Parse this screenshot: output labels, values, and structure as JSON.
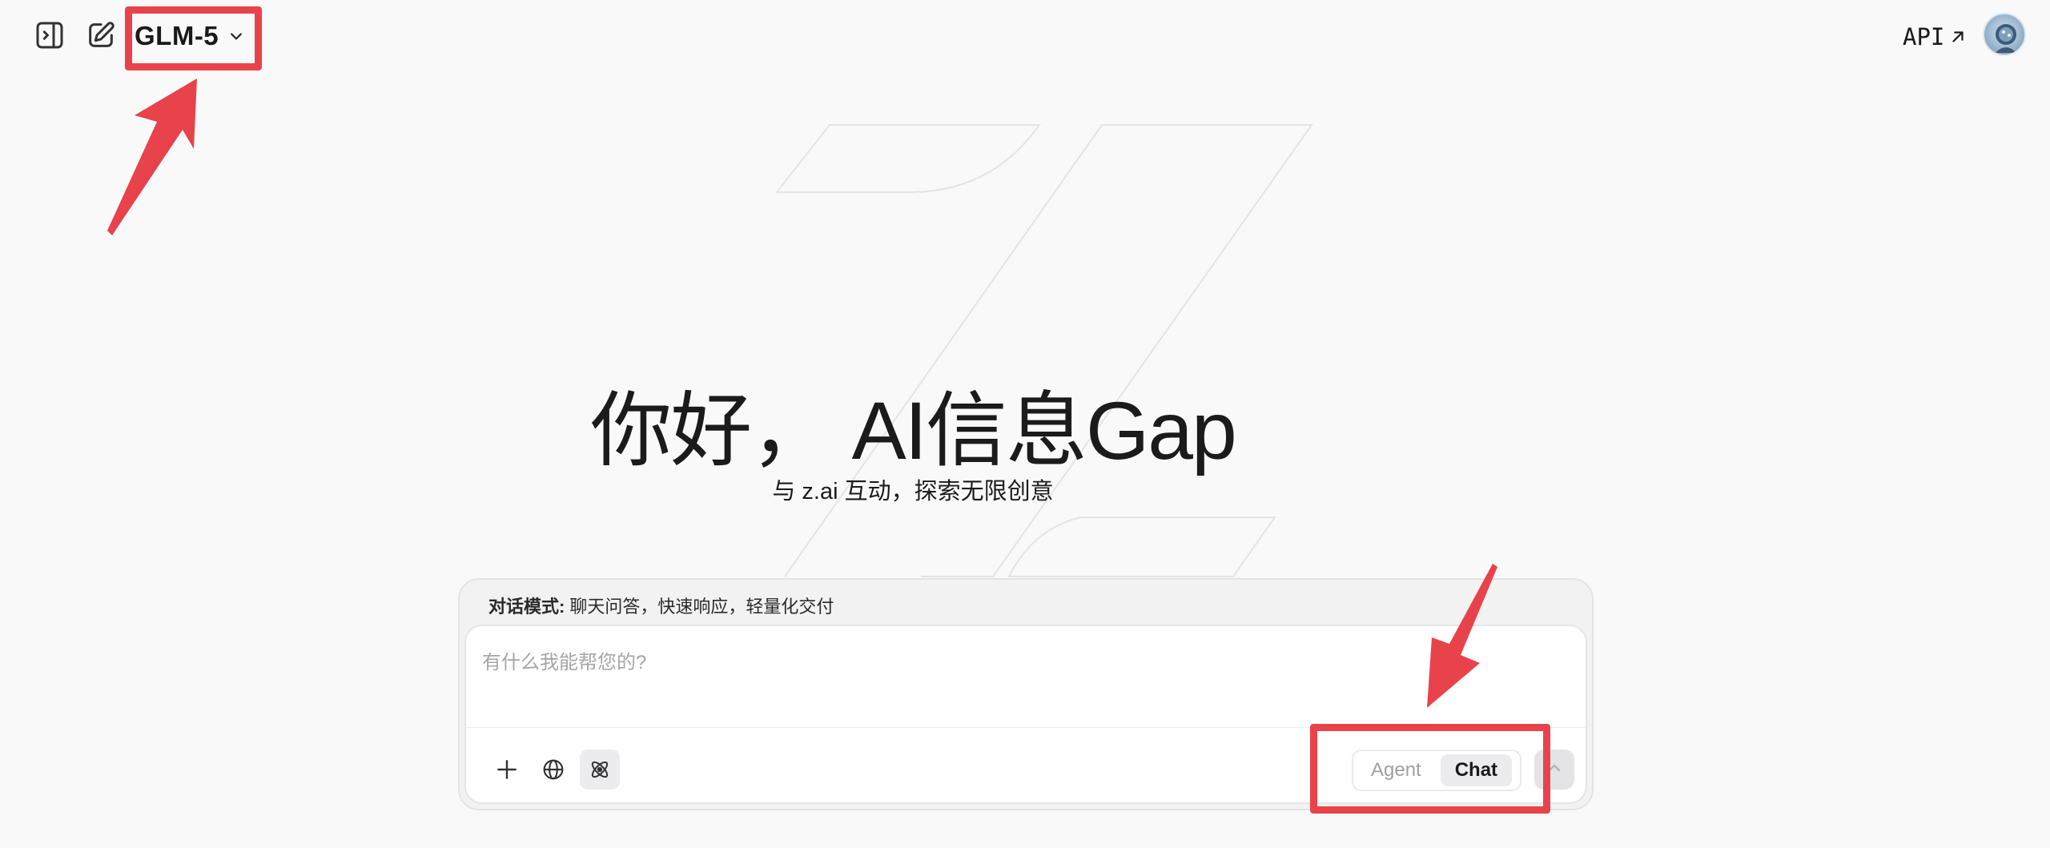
{
  "header": {
    "model_name": "GLM-5",
    "api_label": "API"
  },
  "hero": {
    "greeting": "你好， AI信息Gap",
    "subtitle": "与 z.ai 互动，探索无限创意"
  },
  "composer": {
    "mode_hint_label": "对话模式:",
    "mode_hint_text": "聊天问答，快速响应，轻量化交付",
    "placeholder": "有什么我能帮您的?",
    "modes": [
      "Agent",
      "Chat"
    ],
    "active_mode": "Chat"
  },
  "icons": {
    "sidebar_toggle": "sidebar-toggle-icon",
    "new_chat": "edit-icon",
    "model_dropdown": "chevron-down-icon",
    "api_external": "arrow-up-right-icon",
    "attach": "plus-icon",
    "web_search": "globe-icon",
    "deep_think": "atom-icon",
    "send": "arrow-up-icon"
  },
  "colors": {
    "annotation_red": "#e8434a",
    "background": "#f9f9fa"
  }
}
